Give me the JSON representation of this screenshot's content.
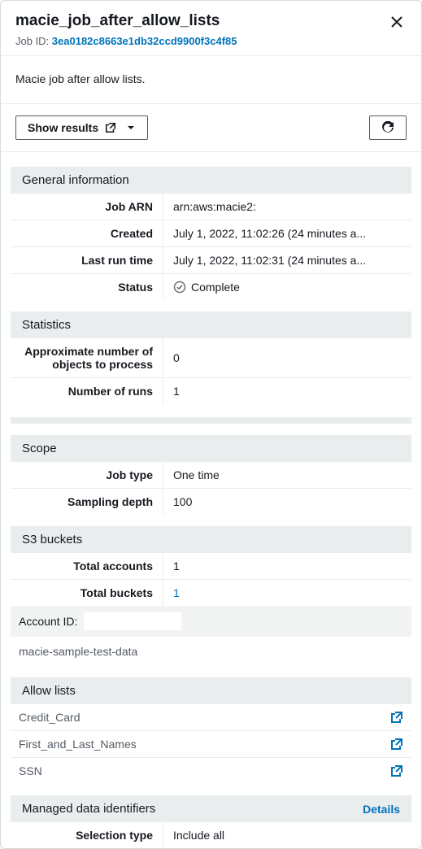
{
  "header": {
    "title": "macie_job_after_allow_lists",
    "job_id_label": "Job ID: ",
    "job_id": "3ea0182c8663e1db32ccd9900f3c4f85"
  },
  "description": "Macie job after allow lists.",
  "actions": {
    "show_results_label": "Show results"
  },
  "sections": {
    "general": {
      "title": "General information",
      "rows": {
        "job_arn": {
          "label": "Job ARN",
          "value": "arn:aws:macie2:"
        },
        "created": {
          "label": "Created",
          "value": "July 1, 2022, 11:02:26 (24 minutes a..."
        },
        "last_run": {
          "label": "Last run time",
          "value": "July 1, 2022, 11:02:31 (24 minutes a..."
        },
        "status": {
          "label": "Status",
          "value": "Complete"
        }
      }
    },
    "statistics": {
      "title": "Statistics",
      "rows": {
        "approx_objects": {
          "label": "Approximate number of objects to process",
          "value": "0"
        },
        "runs": {
          "label": "Number of runs",
          "value": "1"
        }
      }
    },
    "scope": {
      "title": "Scope",
      "rows": {
        "job_type": {
          "label": "Job type",
          "value": "One time"
        },
        "sampling_depth": {
          "label": "Sampling depth",
          "value": "100"
        }
      }
    },
    "s3": {
      "title": "S3 buckets",
      "rows": {
        "total_accounts": {
          "label": "Total accounts",
          "value": "1"
        },
        "total_buckets": {
          "label": "Total buckets",
          "value": "1"
        }
      },
      "account_id_label": "Account ID:",
      "bucket_name": "macie-sample-test-data"
    },
    "allow_lists": {
      "title": "Allow lists",
      "items": [
        "Credit_Card",
        "First_and_Last_Names",
        "SSN"
      ]
    },
    "managed_ids": {
      "title": "Managed data identifiers",
      "details_label": "Details",
      "rows": {
        "selection_type": {
          "label": "Selection type",
          "value": "Include all"
        }
      }
    }
  }
}
